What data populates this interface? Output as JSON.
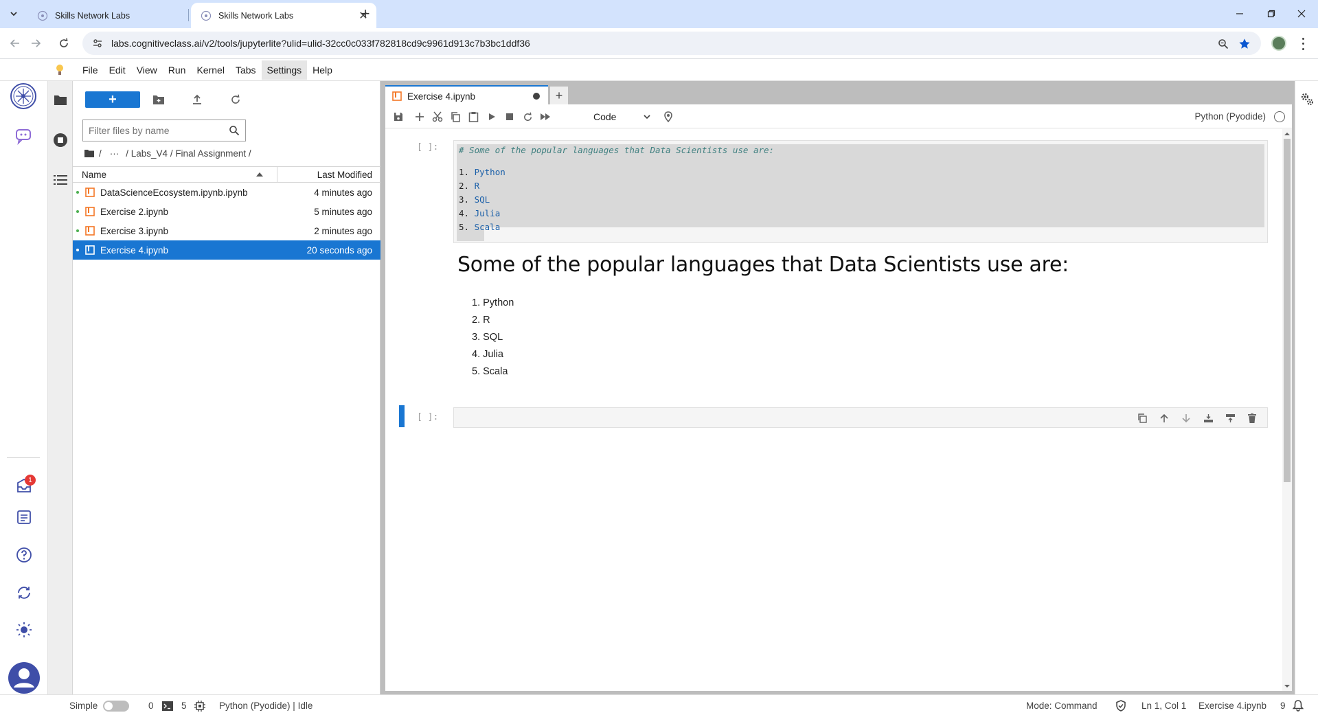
{
  "browser": {
    "tabs": [
      {
        "title": "Skills Network Labs",
        "active": false
      },
      {
        "title": "Skills Network Labs",
        "active": true
      }
    ],
    "url": "labs.cognitiveclass.ai/v2/tools/jupyterlite?ulid=ulid-32cc0c033f782818cd9c9961d913c7b3bc1ddf36"
  },
  "menubar": {
    "items": [
      "File",
      "Edit",
      "View",
      "Run",
      "Kernel",
      "Tabs",
      "Settings",
      "Help"
    ]
  },
  "left_rail": {
    "notification_count": "1"
  },
  "file_browser": {
    "new_label": "+",
    "filter_placeholder": "Filter files by name",
    "breadcrumbs": [
      "/",
      "···",
      "/ Labs_V4 / Final Assignment /"
    ],
    "columns": {
      "name": "Name",
      "modified": "Last Modified"
    },
    "files": [
      {
        "name": "DataScienceEcosystem.ipynb.ipynb",
        "modified": "4 minutes ago",
        "selected": false
      },
      {
        "name": "Exercise 2.ipynb",
        "modified": "5 minutes ago",
        "selected": false
      },
      {
        "name": "Exercise 3.ipynb",
        "modified": "2 minutes ago",
        "selected": false
      },
      {
        "name": "Exercise 4.ipynb",
        "modified": "20 seconds ago",
        "selected": true
      }
    ]
  },
  "notebook": {
    "tab_title": "Exercise 4.ipynb",
    "cell_type": "Code",
    "kernel": "Python (Pyodide)",
    "cells": {
      "code_prompt": "[ ]:",
      "code_comment": "# Some of the popular languages that Data Scientists use are:",
      "code_items": [
        {
          "num": "1.",
          "word": "Python"
        },
        {
          "num": "2.",
          "word": "R"
        },
        {
          "num": "3.",
          "word": "SQL"
        },
        {
          "num": "4.",
          "word": "Julia"
        },
        {
          "num": "5.",
          "word": "Scala"
        }
      ],
      "markdown_heading": "Some of the popular languages that Data Scientists use are:",
      "markdown_items": [
        "1. Python",
        "2. R",
        "3. SQL",
        "4. Julia",
        "5. Scala"
      ],
      "empty_prompt": "[ ]:"
    }
  },
  "status_bar": {
    "mode_label": "Simple",
    "terminals": "0",
    "kernels": "5",
    "kernel_status": "Python (Pyodide) | Idle",
    "mode": "Mode: Command",
    "cursor": "Ln 1, Col 1",
    "file": "Exercise 4.ipynb",
    "notifications": "9"
  },
  "colors": {
    "accent": "#1976d2",
    "tabstrip": "#d3e3fd",
    "badge": "#e53935"
  }
}
